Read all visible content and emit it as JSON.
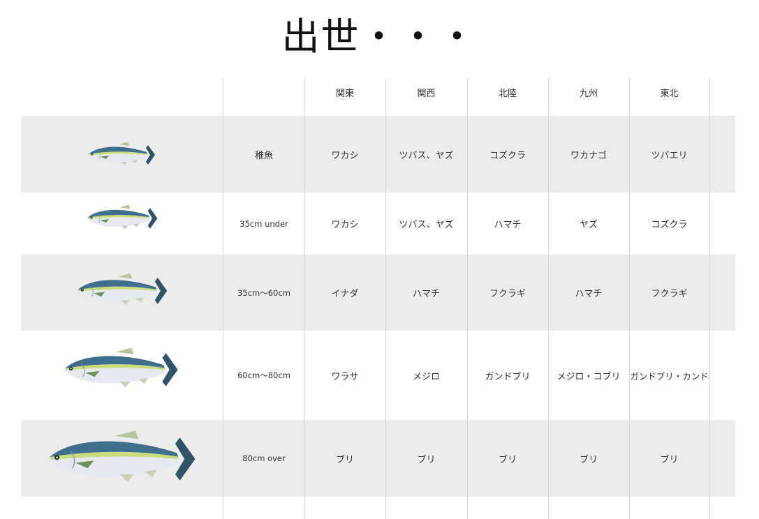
{
  "title": "出世・・・",
  "columns": [
    "関東",
    "関西",
    "北陸",
    "九州",
    "東北"
  ],
  "rows": [
    {
      "stage": "稚魚",
      "names": [
        "ワカシ",
        "ツバス、ヤズ",
        "コズクラ",
        "ワカナゴ",
        "ツバエリ"
      ]
    },
    {
      "stage": "35cm under",
      "names": [
        "ワカシ",
        "ツバス、ヤズ",
        "ハマチ",
        "ヤズ",
        "コズクラ"
      ]
    },
    {
      "stage": "35cm～60cm",
      "names": [
        "イナダ",
        "ハマチ",
        "フクラギ",
        "ハマチ",
        "フクラギ"
      ]
    },
    {
      "stage": "60cm～80cm",
      "names": [
        "ワラサ",
        "メジロ",
        "ガンドブリ",
        "メジロ・コブリ",
        "ガンドブリ・カンド"
      ]
    },
    {
      "stage": "80cm over",
      "names": [
        "ブリ",
        "ブリ",
        "ブリ",
        "ブリ",
        "ブリ"
      ]
    }
  ],
  "colors": {
    "band": "#ececec",
    "fish_back": "#3f6f8c",
    "fish_stripe": "#c8dc7a",
    "fish_belly": "#e6eaee",
    "fish_fin": "#2f5468"
  },
  "icons": [
    "yellowtail-fish-icon"
  ]
}
